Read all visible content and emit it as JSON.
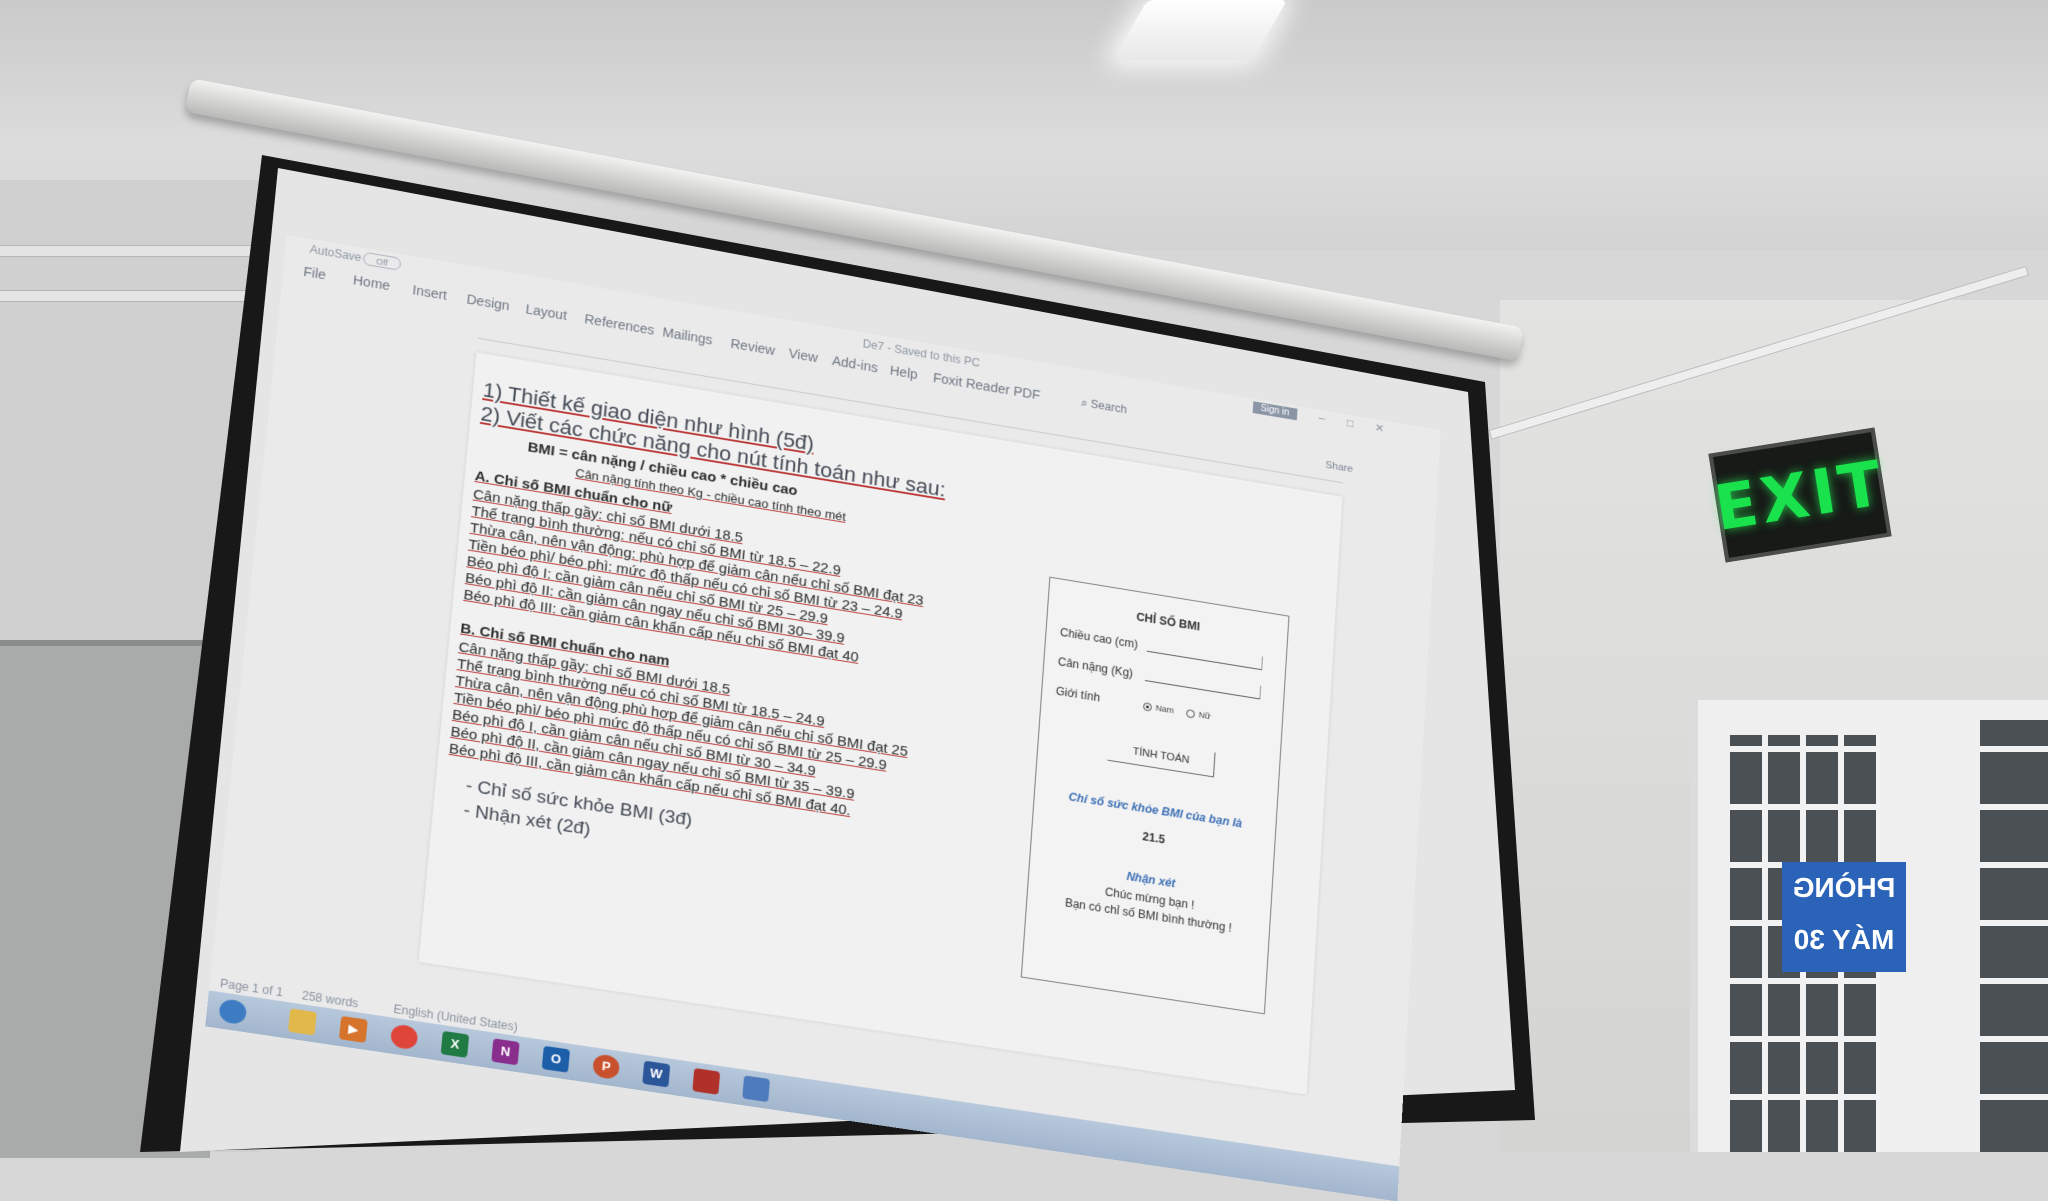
{
  "room": {
    "exit_sign": "EXIT",
    "room_sign": "PHÒNG MÁY 30"
  },
  "word": {
    "autosave_label": "AutoSave",
    "autosave_state": "Off",
    "doc_title": "De7 - Saved to this PC",
    "sign_in": "Sign in",
    "tabs": [
      "File",
      "Home",
      "Insert",
      "Design",
      "Layout",
      "References",
      "Mailings",
      "Review",
      "View",
      "Add-ins",
      "Help",
      "Foxit Reader PDF"
    ],
    "search_label": "Search",
    "share_label": "Share",
    "status": {
      "page": "Page 1 of 1",
      "words": "258 words",
      "language": "English (United States)"
    }
  },
  "doc": {
    "q1": "1)  Thiết kế giao diện như hình (5đ)",
    "q2": "2)  Viết các chức năng cho nút tính toán như sau:",
    "formula_main": "BMI = cân nặng  / chiều cao * chiều cao",
    "formula_sub": "Cân nặng tính theo Kg   - chiều cao tính theo mét",
    "section_a_title": "A. Chỉ số BMI chuẩn cho nữ",
    "section_a": [
      "Cân nặng thấp gầy: chỉ số BMI dưới 18.5",
      "Thể trạng bình thường: nếu có chỉ số BMI từ 18.5 – 22.9",
      "Thừa cân, nên vận động: phù hợp để giảm cân nếu chỉ số BMI đạt 23",
      "Tiền béo phì/ béo phì: mức độ thấp nếu có chỉ số BMI từ 23 – 24.9",
      "Béo phì độ I: cần giảm cân nếu chỉ số BMI từ 25 – 29.9",
      "Béo phì độ II: cần giảm cân ngay nếu chỉ số BMI 30– 39.9",
      "Béo phì độ III: cần giảm cân khẩn cấp nếu chỉ số BMI đạt 40"
    ],
    "section_b_title": "B. Chỉ số BMI chuẩn cho nam",
    "section_b": [
      "Cân nặng thấp gầy: chỉ số BMI dưới 18.5",
      "Thể trạng bình thường nếu có chỉ số BMI từ 18.5 – 24.9",
      "Thừa cân, nên vận động phù hợp để giảm cân nếu chỉ số BMI đạt 25",
      "Tiền béo phì/ béo phì mức độ thấp nếu có chỉ số BMI từ 25 – 29.9",
      "Béo phì độ I, cần giảm cân nếu chỉ số BMI từ 30 – 34.9",
      "Béo phì độ II, cần giảm cân ngay nếu chỉ số BMI từ 35 – 39.9",
      "Béo phì độ III, cần giảm cân khẩn cấp nếu chỉ số BMI đạt 40."
    ],
    "bullet_1": "-   Chỉ số sức khỏe BMI (3đ)",
    "bullet_2": "-   Nhận xét (2đ)"
  },
  "form": {
    "title": "CHỈ SỐ BMI",
    "height_label": "Chiều cao (cm)",
    "weight_label": "Cân nặng (Kg)",
    "gender_label": "Giới tính",
    "gender_options": [
      "Nam",
      "Nữ"
    ],
    "gender_selected": "Nam",
    "calc_button": "TÍNH TOÁN",
    "result_title": "Chỉ số sức khỏe BMI của bạn là",
    "result_value": "21.5",
    "comment_title": "Nhận xét",
    "comment_line1": "Chúc mừng bạn !",
    "comment_line2": "Bạn có chỉ số BMI bình thường !"
  },
  "taskbar": {
    "apps": [
      "start-icon",
      "file-explorer-icon",
      "media-player-icon",
      "chrome-icon",
      "excel-icon",
      "onenote-icon",
      "outlook-icon",
      "powerpoint-icon",
      "word-icon",
      "acrobat-icon",
      "network-icon"
    ]
  }
}
